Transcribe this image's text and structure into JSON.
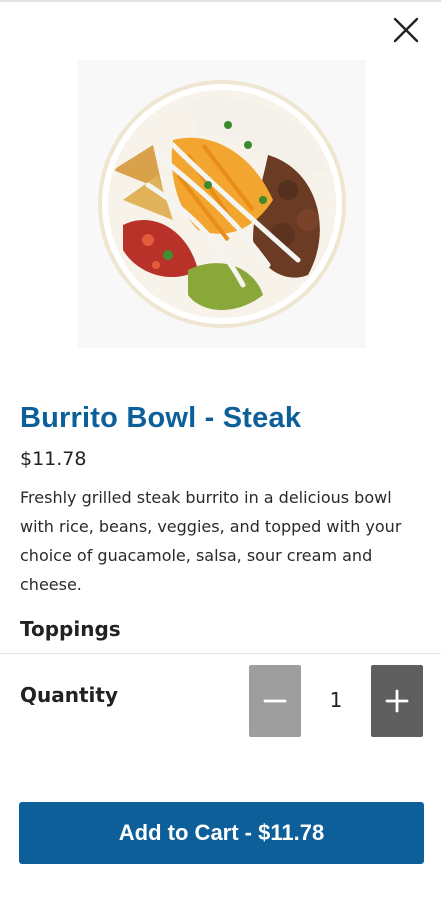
{
  "product": {
    "title": "Burrito Bowl - Steak",
    "price": "$11.78",
    "description": "Freshly grilled steak burrito in a delicious bowl with rice, beans, veggies, and topped with your choice of guacamole, salsa, sour cream and cheese.",
    "image_alt": "burrito bowl photo"
  },
  "sections": {
    "toppings_title": "Toppings",
    "quantity_label": "Quantity"
  },
  "quantity": {
    "value": "1",
    "minus_icon": "minus-icon",
    "plus_icon": "plus-icon"
  },
  "cart": {
    "button_label": "Add to Cart - $11.78"
  },
  "icons": {
    "close": "close-icon"
  },
  "colors": {
    "brand_blue": "#0d5f9a",
    "minus_button": "#9e9e9e",
    "plus_button": "#5f5f5f"
  }
}
